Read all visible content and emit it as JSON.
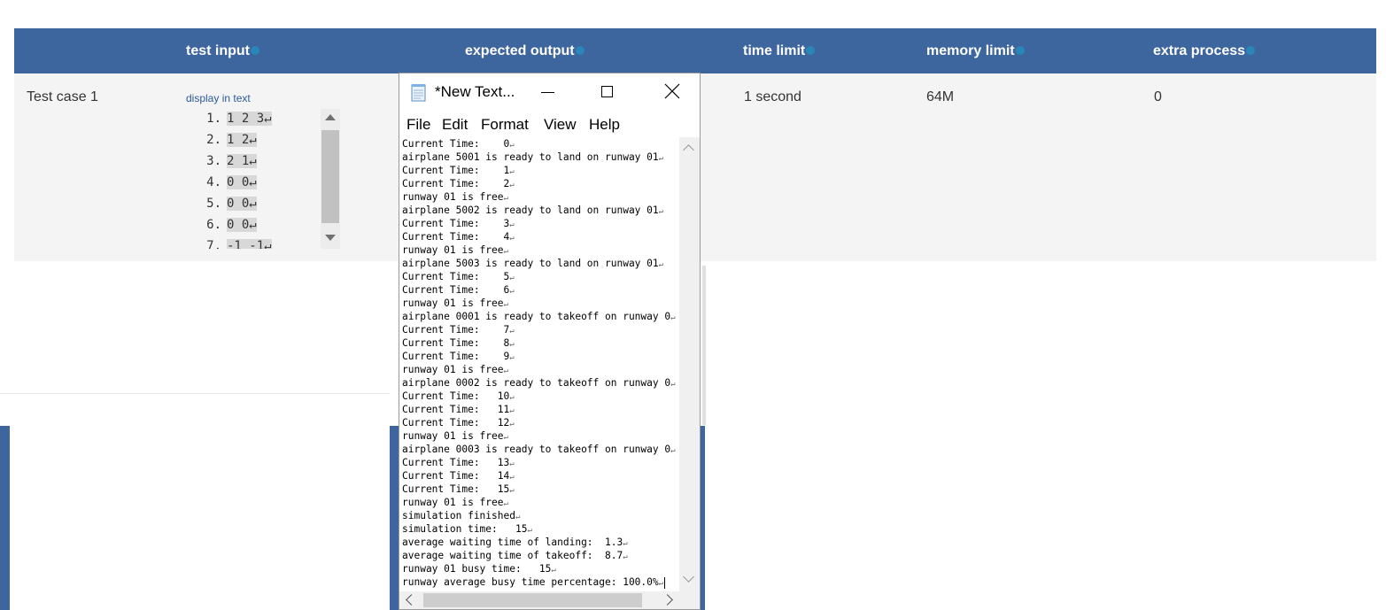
{
  "table": {
    "headers": [
      {
        "label": "test input"
      },
      {
        "label": "expected output"
      },
      {
        "label": "time limit"
      },
      {
        "label": "memory limit"
      },
      {
        "label": "extra process"
      }
    ],
    "row": {
      "name": "Test case 1",
      "display_link": "display in text",
      "time_limit": "1 second",
      "memory_limit": "64M",
      "extra_process": "0",
      "input_lines": [
        {
          "num": "1.",
          "text": "1 2 3↵"
        },
        {
          "num": "2.",
          "text": "1 2↵"
        },
        {
          "num": "3.",
          "text": "2 1↵"
        },
        {
          "num": "4.",
          "text": "0 0↵"
        },
        {
          "num": "5.",
          "text": "0 0↵"
        },
        {
          "num": "6.",
          "text": "0 0↵"
        },
        {
          "num": "7.",
          "text": "-1 -1↵"
        }
      ]
    }
  },
  "notepad": {
    "title": "*New Text...",
    "menu": [
      "File",
      "Edit",
      "Format",
      "View",
      "Help"
    ],
    "lines": [
      "Current Time:    0",
      "airplane 5001 is ready to land on runway 01",
      "Current Time:    1",
      "Current Time:    2",
      "runway 01 is free",
      "airplane 5002 is ready to land on runway 01",
      "Current Time:    3",
      "Current Time:    4",
      "runway 01 is free",
      "airplane 5003 is ready to land on runway 01",
      "Current Time:    5",
      "Current Time:    6",
      "runway 01 is free",
      "airplane 0001 is ready to takeoff on runway 0",
      "Current Time:    7",
      "Current Time:    8",
      "Current Time:    9",
      "runway 01 is free",
      "airplane 0002 is ready to takeoff on runway 0",
      "Current Time:   10",
      "Current Time:   11",
      "Current Time:   12",
      "runway 01 is free",
      "airplane 0003 is ready to takeoff on runway 0",
      "Current Time:   13",
      "Current Time:   14",
      "Current Time:   15",
      "runway 01 is free",
      "simulation finished",
      "simulation time:   15",
      "average waiting time of landing:  1.3",
      "average waiting time of takeoff:  8.7",
      "runway 01 busy time:   15",
      "runway average busy time percentage: 100.0%"
    ]
  },
  "colors": {
    "header_bg": "#3e669e",
    "row_bg": "#f4f4f4",
    "info_dot": "#2a86b8",
    "link": "#2c5a9a"
  },
  "icons": {
    "header_info": "info-icon",
    "notepad_app": "notepad-icon",
    "minimize": "minimize-icon",
    "maximize": "maximize-icon",
    "close": "close-icon"
  }
}
